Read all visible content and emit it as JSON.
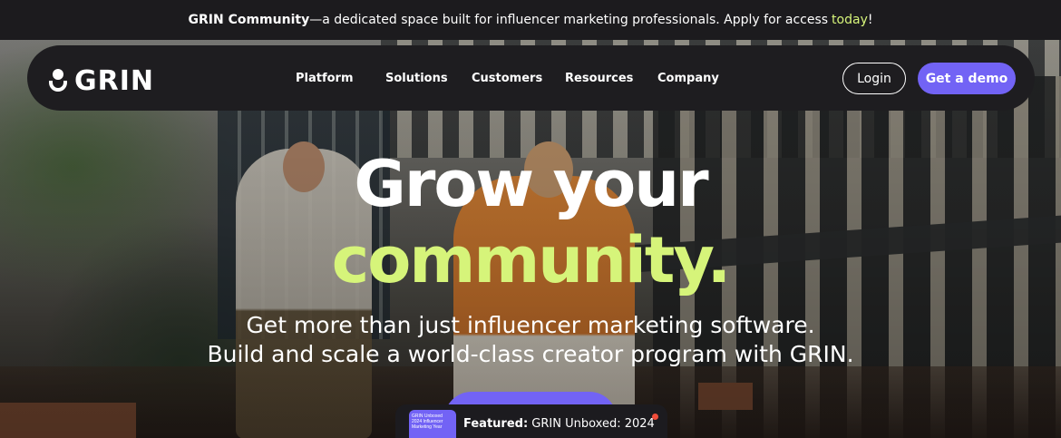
{
  "announcement": {
    "brand": "GRIN Community",
    "text": "—a dedicated space built for influencer marketing professionals. Apply for access",
    "link": "today",
    "suffix": "!",
    "link_color": "#d6f47a"
  },
  "nav": {
    "logo_text": "GRIN",
    "items": [
      {
        "label": "Platform"
      },
      {
        "label": "Solutions"
      },
      {
        "label": "Customers"
      },
      {
        "label": "Resources"
      },
      {
        "label": "Company"
      }
    ],
    "login_label": "Login",
    "demo_label": "Get a demo",
    "accent_color": "#7263f5"
  },
  "hero": {
    "headline_line1": "Grow your",
    "headline_line2": "community.",
    "subhead_line1": "Get more than just influencer marketing software.",
    "subhead_line2": "Build and scale a world-class creator program with GRIN.",
    "highlight_color": "#d6f47a"
  },
  "featured": {
    "label": "Featured:",
    "title": "GRIN Unboxed: 2024",
    "thumb_text": "GRIN Unboxed 2024 Influencer Marketing Year"
  }
}
